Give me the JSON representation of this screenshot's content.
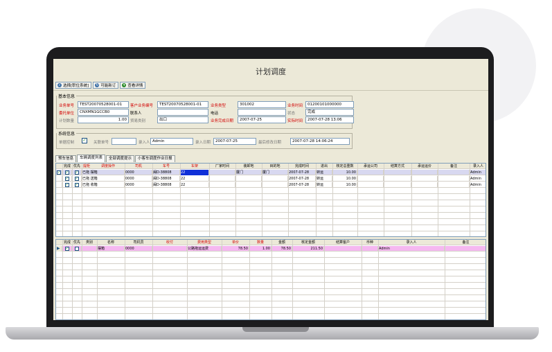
{
  "window": {
    "title": "计划调度"
  },
  "toolbar": {
    "buttons": [
      {
        "label": "选择[职位系统]",
        "icon": "search-icon"
      },
      {
        "label": "可能新订",
        "icon": "refresh-icon"
      },
      {
        "label": "查看详情",
        "icon": "chevron-down-icon"
      }
    ]
  },
  "basic_info": {
    "legend": "基本信息",
    "order_no_label": "业务单号",
    "order_no": "TEST20070528001-01",
    "customer_order_label": "客户业务编号",
    "customer_order": "TEST20070528001-01",
    "business_type_label": "业务类型",
    "business_type": "301002",
    "business_date_label": "业务时间",
    "business_date": "01200101000000",
    "consignor_label": "委托单位",
    "consignor": "CNXMN1GCCB0",
    "contact_label": "联系人",
    "contact": "",
    "phone_label": "电话",
    "phone": "",
    "status_label": "状态",
    "status": "完成",
    "plan_qty_label": "计划数量",
    "plan_qty": "1.00",
    "trade_mode_label": "贸易类别",
    "trade_mode": "出口",
    "plan_finish_label": "业务完成日期",
    "plan_finish": "2007-07-25",
    "actual_finish_label": "实际时间",
    "actual_finish": "2007-07-28 13:06"
  },
  "system_info": {
    "legend": "系统信息",
    "sync_label": "单据控制",
    "sync_checked": true,
    "rel_label": "关联单号",
    "rel_value": "",
    "creator_label": "录入人",
    "creator": "Admin",
    "create_date_label": "录入日期",
    "create_date": "2007-07-25",
    "modify_date_label": "最后修改日期",
    "modify_date": "2007-07-28 14:06:24"
  },
  "tabs": [
    {
      "label": "预车信息"
    },
    {
      "label": "车辆调度列表"
    },
    {
      "label": "全部调度提示"
    },
    {
      "label": "小客车调度作业日报"
    }
  ],
  "upper_grid": {
    "columns": [
      "完成",
      "优先",
      "提柜",
      "调度操作",
      "司机",
      "车号",
      "车架",
      "厂家时间",
      "装卸地",
      "目的地",
      "完成时间",
      "进出",
      "核定总重数",
      "承运公司",
      "结算方式",
      "承运运价",
      "备注",
      "录入人"
    ],
    "rows": [
      {
        "done": true,
        "priority": true,
        "pick": true,
        "op": "已拖 摆箱",
        "driver": "0000",
        "truck": "闽D-38808",
        "frame": "22",
        "factory_time": "",
        "load": "厦门",
        "dest": "厦门",
        "finish": "2007-07-28",
        "io": "转运",
        "weight": "10.00",
        "carrier": "",
        "pay": "",
        "price": "",
        "note": "",
        "creator": "Admin"
      },
      {
        "done": false,
        "priority": true,
        "pick": true,
        "op": "已拖 送箱",
        "driver": "0000",
        "truck": "闽D-38808",
        "frame": "22",
        "factory_time": "",
        "load": "",
        "dest": "",
        "finish": "2007-07-28",
        "io": "转运",
        "weight": "10.00",
        "carrier": "",
        "pay": "",
        "price": "",
        "note": "",
        "creator": "Admin"
      },
      {
        "done": false,
        "priority": true,
        "pick": true,
        "op": "已拖 收箱",
        "driver": "0000",
        "truck": "闽D-38808",
        "frame": "22",
        "factory_time": "",
        "load": "",
        "dest": "",
        "finish": "2007-07-28",
        "io": "转运",
        "weight": "10.00",
        "carrier": "",
        "pay": "",
        "price": "",
        "note": "",
        "creator": "Admin"
      }
    ]
  },
  "lower_grid": {
    "columns": [
      "完成",
      "优先",
      "类别",
      "名称",
      "司机员",
      "收付",
      "费用类型",
      "单价",
      "数量",
      "金额",
      "核定金额",
      "结算客户",
      "币种",
      "录入人",
      "备注"
    ],
    "rows": [
      {
        "done": true,
        "priority": false,
        "kind": "",
        "name": "摆箱",
        "driver": "0000",
        "recv": "",
        "fee_type": "公路拖运运费",
        "price": "78.50",
        "qty": "1.00",
        "amount": "78.50",
        "approved": "211.50",
        "customer": "",
        "currency": "",
        "creator": "Admin",
        "note": ""
      }
    ]
  }
}
